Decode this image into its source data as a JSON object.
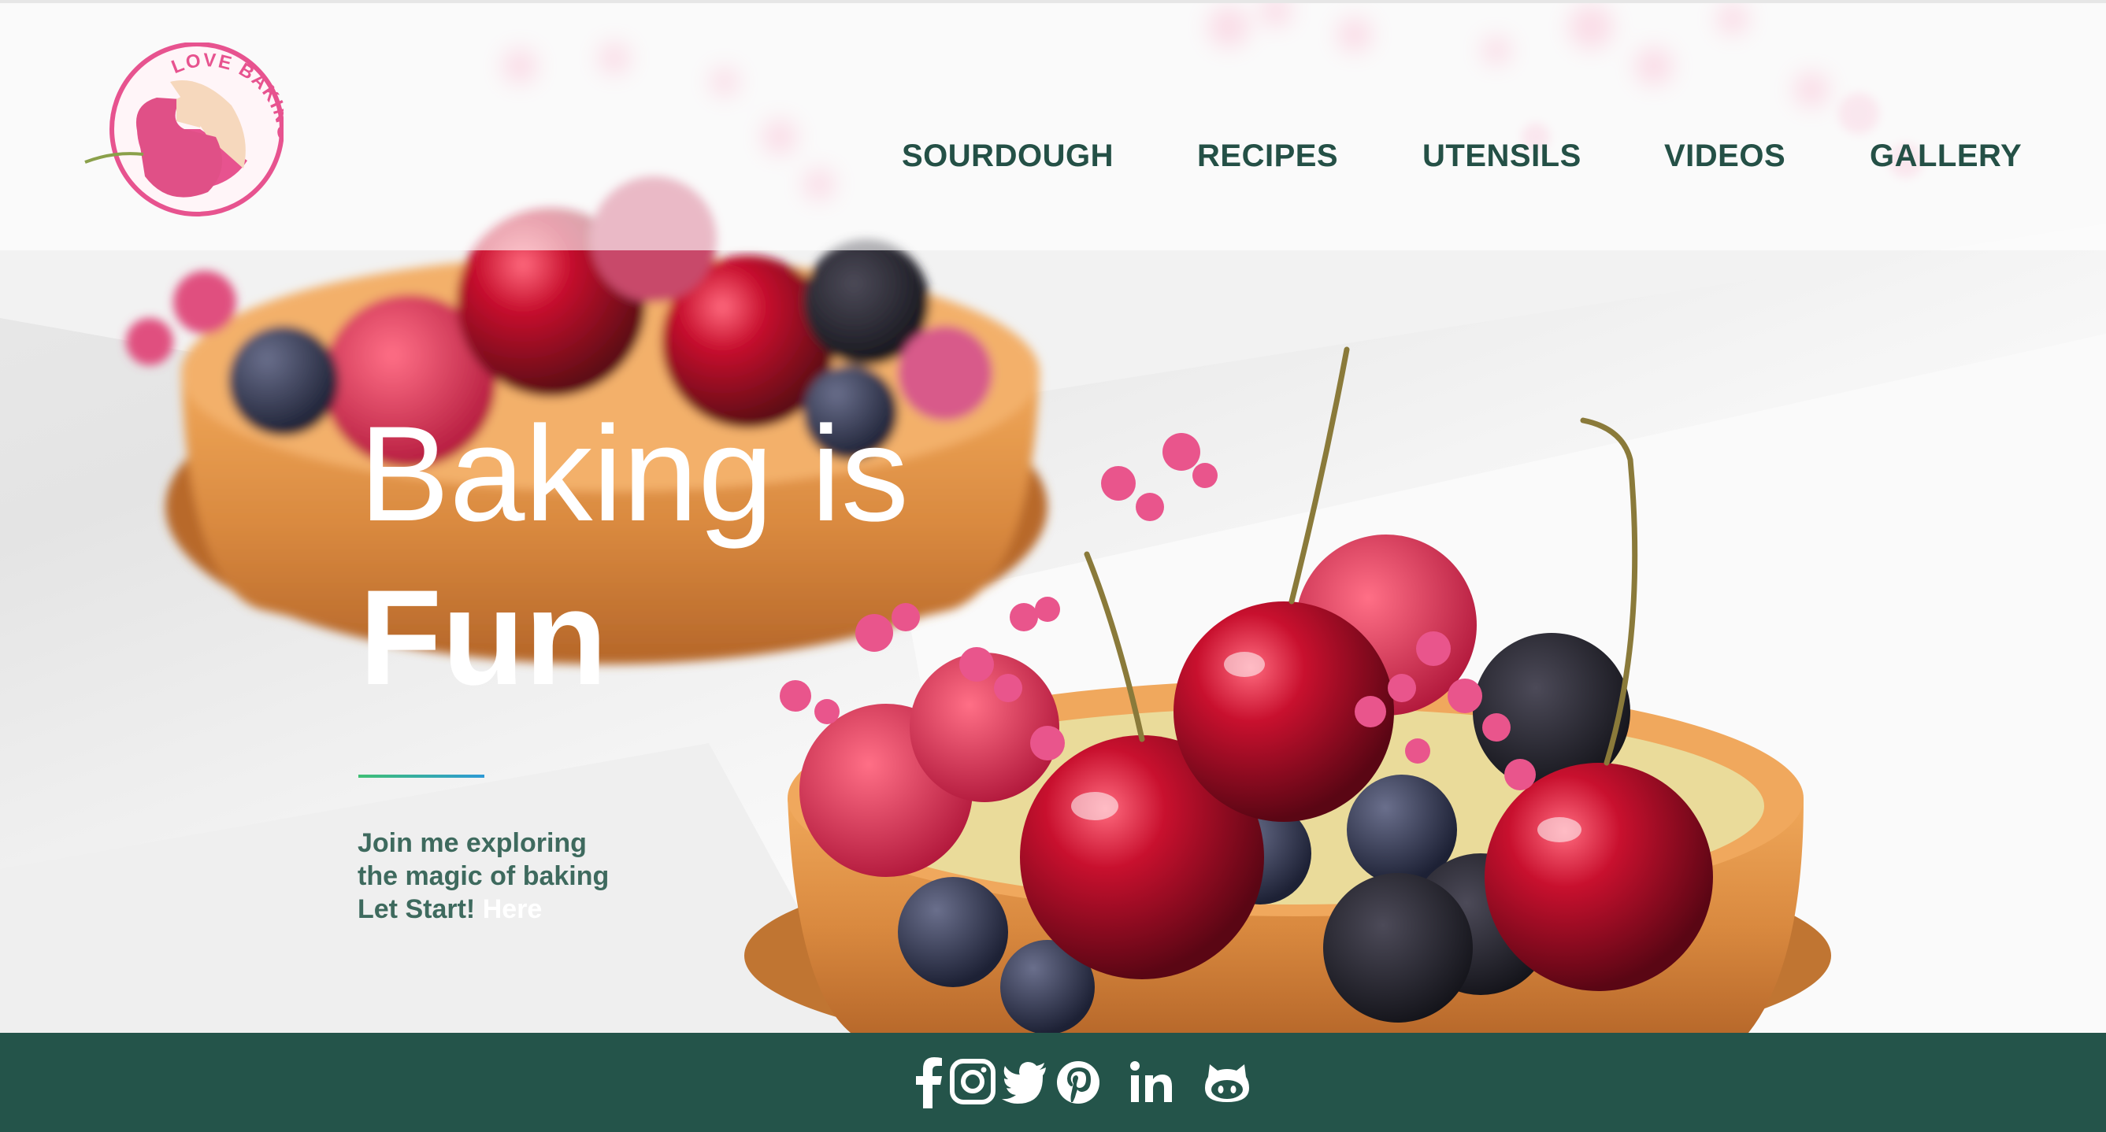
{
  "brand": {
    "logo_text": "LOVE BAKING",
    "colors": {
      "pink": "#e7538f",
      "peach": "#f6d8bd",
      "green": "#24544a",
      "accent_green": "#3fbf74",
      "accent_blue": "#2d9ad6"
    }
  },
  "nav": {
    "items": [
      {
        "label": "SOURDOUGH"
      },
      {
        "label": "RECIPES"
      },
      {
        "label": "UTENSILS"
      },
      {
        "label": "VIDEOS"
      },
      {
        "label": "GALLERY"
      }
    ]
  },
  "hero": {
    "headline_line1": "Baking is",
    "headline_line2": "Fun",
    "tagline_line1": "Join me exploring",
    "tagline_line2": "the magic of baking",
    "tagline_line3_prefix": "Let Start!",
    "tagline_link": "Here",
    "background_image": "berry tart with cherries, raspberries, blackberries and pink baby's breath flowers"
  },
  "footer": {
    "social_icons": [
      "facebook-icon",
      "instagram-icon",
      "twitter-icon",
      "pinterest-icon",
      "linkedin-icon",
      "github-icon"
    ]
  }
}
